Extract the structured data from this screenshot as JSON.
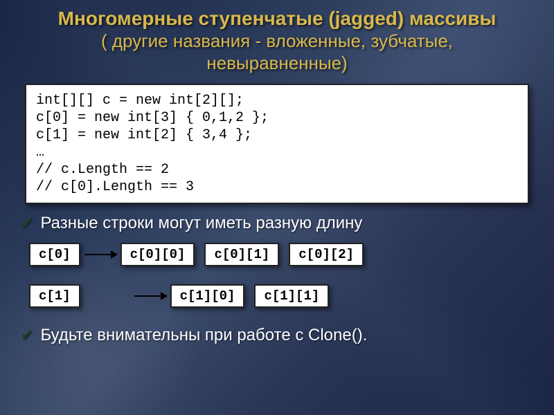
{
  "title": "Многомерные ступенчатые (jagged) массивы",
  "subtitle_line1": "( другие названия - вложенные, зубчатые,",
  "subtitle_line2": "невыравненные)",
  "code": "int[][] c = new int[2][];\nc[0] = new int[3] { 0,1,2 };\nc[1] = new int[2] { 3,4 };\n…\n// c.Length == 2\n// c[0].Length == 3",
  "bullets": {
    "b1": "Разные строки могут иметь разную длину",
    "b2": "Будьте внимательны при работе с  Clone()."
  },
  "diagram": {
    "r1": {
      "head": "c[0]",
      "cells": [
        "c[0][0]",
        "c[0][1]",
        "c[0][2]"
      ]
    },
    "r2": {
      "head": "c[1]",
      "cells": [
        "c[1][0]",
        "c[1][1]"
      ]
    }
  }
}
